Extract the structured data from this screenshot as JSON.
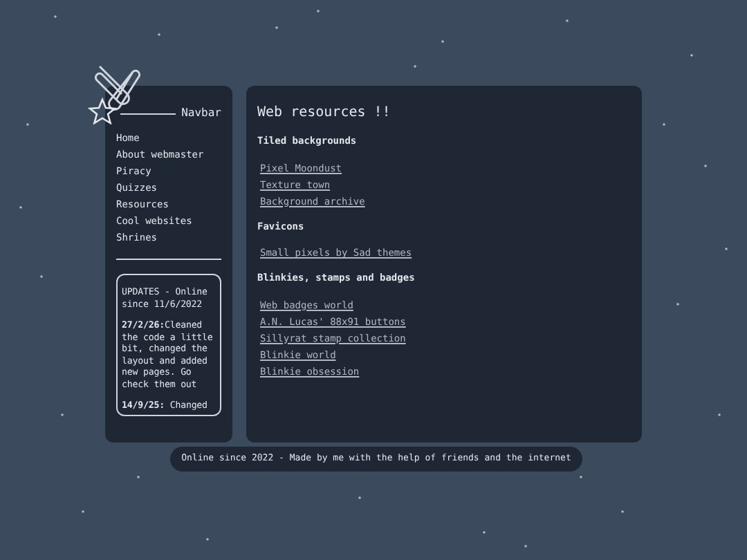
{
  "navbar": {
    "heading": "Navbar",
    "items": [
      "Home",
      "About webmaster",
      "Piracy",
      "Quizzes",
      "Resources",
      "Cool websites",
      "Shrines"
    ]
  },
  "updates": {
    "heading": "UPDATES - Online since 11/6/2022",
    "entries": [
      {
        "date": "27/2/26:",
        "text": "Cleaned the code a little bit, changed the layout and added new pages. Go check them out"
      },
      {
        "date": "14/9/25:",
        "text": " Changed"
      }
    ]
  },
  "main": {
    "title": "Web resources !!",
    "sections": [
      {
        "heading": "Tiled backgrounds",
        "links": [
          "Pixel Moondust",
          "Texture town",
          "Background archive"
        ]
      },
      {
        "heading": "Favicons",
        "links": [
          "Small pixels by Sad themes"
        ]
      },
      {
        "heading": "Blinkies, stamps and badges",
        "links": [
          "Web badges world",
          "A.N. Lucas' 88x91 buttons",
          "Sillyrat stamp collection",
          "Blinkie world",
          "Blinkie obsession"
        ]
      }
    ]
  },
  "footer": "Online since 2022 - Made by me with the help of friends and the internet"
}
